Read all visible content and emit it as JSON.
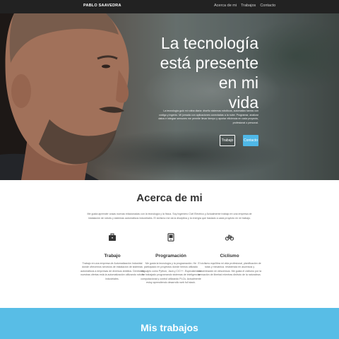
{
  "nav": {
    "brand": "PABLO SAAVEDRA",
    "links": [
      "Acerca de mi",
      "Trabajos",
      "Contacto"
    ]
  },
  "hero": {
    "title_lines": [
      "La tecnología",
      "está presente en mi",
      "vida"
    ],
    "text": "La tecnología guió mi rutina diaria: diseño sistemas robóticos, automatizo tareas con código y ingenio. Mi jornada con aplicaciones conectadas a la nube. Programar, analizar datos e integrar sensores me permite llevar tiempo y aportar eficiencia en cada proyecto, profesional o personal.",
    "buttons": {
      "works": "Trabajo",
      "contact": "Contacto"
    }
  },
  "about": {
    "title": "Acerca de mi",
    "text": "Me gusta aprender cosas nuevas relacionadas con la tecnología y la física. Soy Ingeniero Civil Eléctrico y Actualmente trabajo en una empresa de instalación de robots y sistemas automáticos industriales. El ciclismo me da la disciplina y la energía que traslado a cada proyecto en mi trabajo.",
    "cards": [
      {
        "icon": "briefcase-icon",
        "title": "Trabajo",
        "text": "Trabajo en una empresa de Automatización Industrial donde ofrecemos servicios de instalación de sistemas automáticos a empresas de diversos ámbitos. Dentro de nuestras ofertas está la automatización utilizando robots industriales."
      },
      {
        "icon": "computer-icon",
        "title": "Programación",
        "text": "Me gusta la tecnología y la programación. He participado en proyectos donde hemos utilizado lenguajes como Python, Java y C/C++. Especialmente he trabajado programando sistemas de inteligencia computacional y control utilizando PLCs. Actualmente estoy aprendiendo desarrollo web full stack."
      },
      {
        "icon": "bicycle-icon",
        "title": "Ciclismo",
        "text": "El ciclismo equilibra mi vida profesional, planificación de rutas y mecánica. resistencia en ascensos y concentración en descensos. Me gusta el ciclismo por la sensación de libertad mientras disfruto de la naturaleza."
      }
    ]
  },
  "works": {
    "title": "Mis trabajos"
  },
  "colors": {
    "navbar": "#222222",
    "accent": "#58bde6",
    "button_primary": "#4fb8e8"
  }
}
